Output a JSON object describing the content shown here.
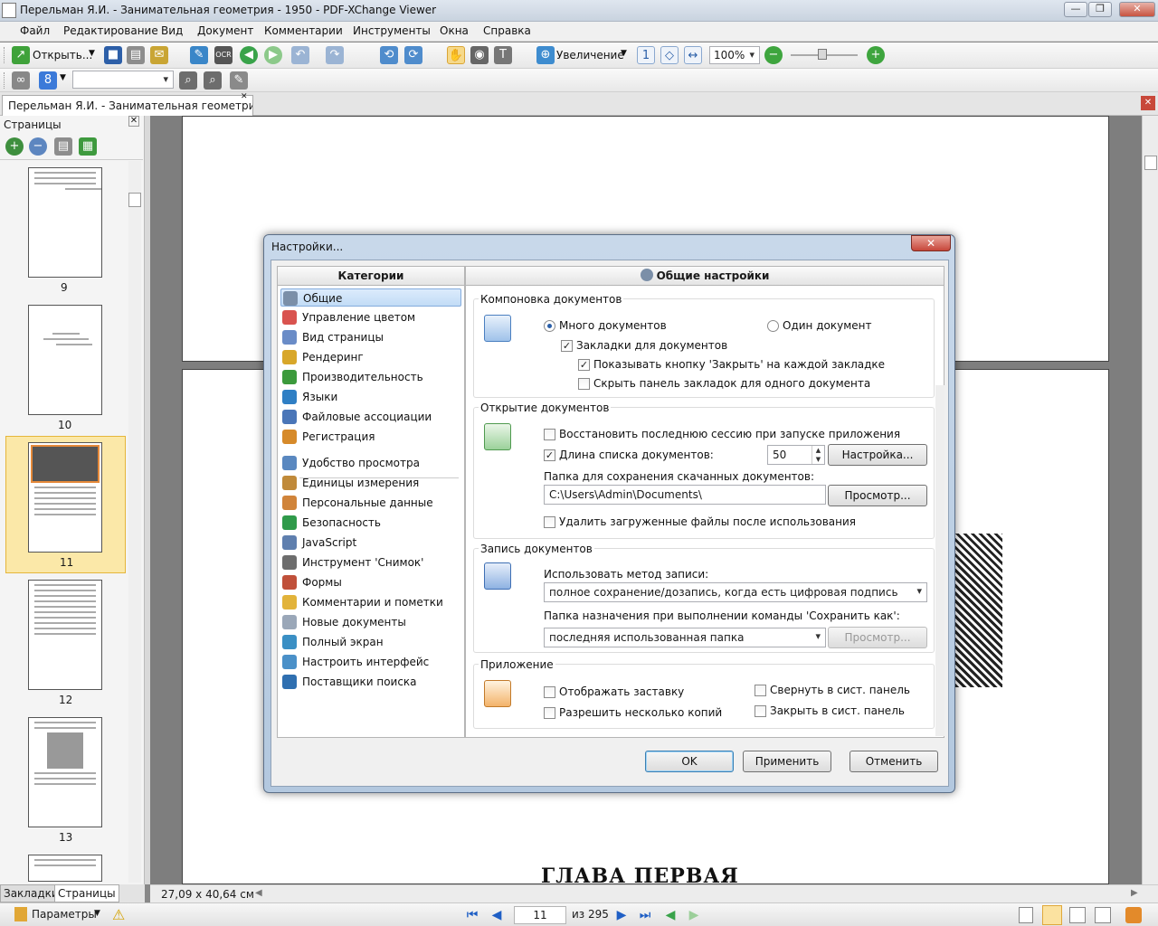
{
  "window": {
    "title": "Перельман Я.И. - Занимательная геометрия - 1950 - PDF-XChange Viewer"
  },
  "menu": [
    "Файл",
    "Редактирование",
    "Вид",
    "Документ",
    "Комментарии",
    "Инструменты",
    "Окна",
    "Справка"
  ],
  "toolbar": {
    "open_label": "Открыть...",
    "zoom_label": "Увеличение",
    "zoom_value": "100%"
  },
  "tab": {
    "label": "Перельман Я.И. - Занимательная геометри..."
  },
  "side_panel": {
    "title": "Страницы",
    "thumbnails": [
      "9",
      "10",
      "11",
      "12",
      "13"
    ],
    "selected": "11"
  },
  "bottom_tabs": [
    "Закладки",
    "Страницы"
  ],
  "dimensions": "27,09 x 40,64 см",
  "page_heading": "ГЛАВА ПЕРВАЯ",
  "status": {
    "params_label": "Параметры",
    "current_page": "11",
    "of_total": "из 295"
  },
  "dialog": {
    "title": "Настройки...",
    "categories_header": "Категории",
    "settings_header": "Общие настройки",
    "categories": [
      {
        "label": "Общие",
        "icon": "gears-icon",
        "color": "#7b8fa8"
      },
      {
        "label": "Управление цветом",
        "icon": "color-management-icon",
        "color": "#d9534f"
      },
      {
        "label": "Вид страницы",
        "icon": "page-view-icon",
        "color": "#6a8cc7"
      },
      {
        "label": "Рендеринг",
        "icon": "rendering-icon",
        "color": "#d8a72a"
      },
      {
        "label": "Производительность",
        "icon": "performance-icon",
        "color": "#3c9a3c"
      },
      {
        "label": "Языки",
        "icon": "globe-icon",
        "color": "#2f7fc4"
      },
      {
        "label": "Файловые ассоциации",
        "icon": "file-associations-icon",
        "color": "#4a76b8"
      },
      {
        "label": "Регистрация",
        "icon": "registration-icon",
        "color": "#d68a2a"
      },
      {
        "label": "Удобство просмотра",
        "icon": "accessibility-icon",
        "color": "#5a88c0"
      },
      {
        "label": "Единицы измерения",
        "icon": "ruler-icon",
        "color": "#c08a3a"
      },
      {
        "label": "Персональные данные",
        "icon": "user-icon",
        "color": "#d0843a"
      },
      {
        "label": "Безопасность",
        "icon": "shield-icon",
        "color": "#2f9a4a"
      },
      {
        "label": "JavaScript",
        "icon": "javascript-icon",
        "color": "#5f7fae"
      },
      {
        "label": "Инструмент 'Снимок'",
        "icon": "snapshot-icon",
        "color": "#6d6d6d"
      },
      {
        "label": "Формы",
        "icon": "forms-icon",
        "color": "#c0503a"
      },
      {
        "label": "Комментарии и пометки",
        "icon": "comments-icon",
        "color": "#e2b33a"
      },
      {
        "label": "Новые документы",
        "icon": "new-document-icon",
        "color": "#9aa7b8"
      },
      {
        "label": "Полный экран",
        "icon": "fullscreen-icon",
        "color": "#3a8fc4"
      },
      {
        "label": "Настроить интерфейс",
        "icon": "customize-ui-icon",
        "color": "#4a90c8"
      },
      {
        "label": "Поставщики поиска",
        "icon": "search-providers-icon",
        "color": "#2f6fb0"
      }
    ],
    "layout_group": {
      "title": "Компоновка документов",
      "many_docs": "Много документов",
      "single_doc": "Один документ",
      "doc_tabs": "Закладки для документов",
      "show_close": "Показывать кнопку 'Закрыть' на каждой закладке",
      "hide_tabs": "Скрыть панель закладок для одного документа"
    },
    "open_group": {
      "title": "Открытие документов",
      "restore_session": "Восстановить последнюю сессию при запуске приложения",
      "recent_list": "Длина списка документов:",
      "recent_count": "50",
      "setup_button": "Настройка...",
      "download_folder_label": "Папка для сохранения скачанных документов:",
      "download_folder": "C:\\Users\\Admin\\Documents\\",
      "browse_button": "Просмотр...",
      "delete_downloaded": "Удалить загруженные файлы после использования"
    },
    "save_group": {
      "title": "Запись документов",
      "method_label": "Использовать метод записи:",
      "method_value": "полное сохранение/дозапись, когда есть цифровая подпись",
      "saveas_label": "Папка назначения при выполнении команды 'Сохранить как':",
      "saveas_value": "последняя использованная папка",
      "browse_button": "Просмотр..."
    },
    "app_group": {
      "title": "Приложение",
      "splash": "Отображать заставку",
      "multi_instance": "Разрешить несколько копий",
      "minimize_tray": "Свернуть в сист. панель",
      "close_tray": "Закрыть в сист. панель"
    },
    "buttons": {
      "ok": "OK",
      "apply": "Применить",
      "cancel": "Отменить"
    }
  }
}
